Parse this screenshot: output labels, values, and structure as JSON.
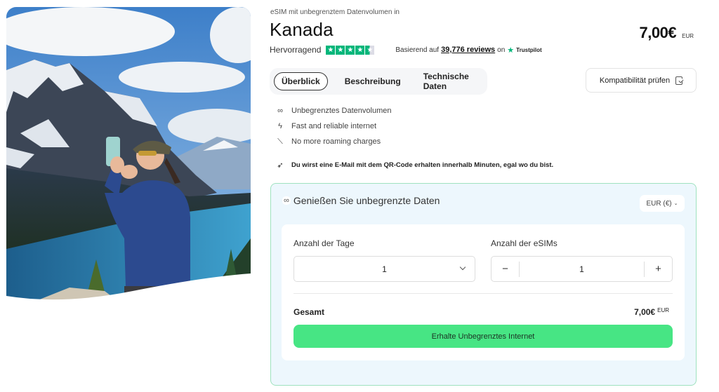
{
  "hero": {
    "image_description": "Woman taking a selfie in front of snowy mountains and a turquoise lake"
  },
  "product": {
    "kicker": "eSIM mit unbegrenztem Datenvolumen in",
    "title": "Kanada",
    "price": "7,00€",
    "currency_code": "EUR"
  },
  "rating": {
    "word": "Hervorragend",
    "stars": 4.5,
    "max_stars": 5,
    "based_on": "Basierend auf",
    "reviews_count": "39,776 reviews",
    "on": "on",
    "provider": "Trustpilot",
    "star_color": "#00b67a"
  },
  "tabs": [
    {
      "label": "Überblick",
      "active": true
    },
    {
      "label": "Beschreibung",
      "active": false
    },
    {
      "label": "Technische Daten",
      "active": false
    }
  ],
  "compat_button": {
    "label": "Kompatibilität prüfen",
    "icon": "phone-check-icon"
  },
  "features": [
    {
      "icon": "infinity-icon",
      "glyph": "∞",
      "text": "Unbegrenztes Datenvolumen"
    },
    {
      "icon": "lightning-icon",
      "glyph": "ϟ",
      "text": "Fast and reliable internet"
    },
    {
      "icon": "no-roaming-icon",
      "glyph": "⟍",
      "text": "No more roaming charges"
    }
  ],
  "notice": {
    "icon": "rocket-icon",
    "glyph": "🚀",
    "text": "Du wirst eine E-Mail mit dem QR-Code erhalten innerhalb Minuten, egal wo du bist."
  },
  "plan": {
    "heading": "Genießen Sie unbegrenzte Daten",
    "heading_icon": "∞",
    "currency_select": "EUR (€)",
    "days_label": "Anzahl der Tage",
    "days_value": "1",
    "esims_label": "Anzahl der eSIMs",
    "esims_value": "1",
    "minus": "−",
    "plus": "+",
    "total_label": "Gesamt",
    "total_value": "7,00€",
    "total_currency": "EUR",
    "cta_label": "Erhalte Unbegrenztes Internet",
    "cta_color": "#47e584",
    "card_border_color": "#9fe2bf",
    "card_bg_color": "#edf7fd"
  }
}
